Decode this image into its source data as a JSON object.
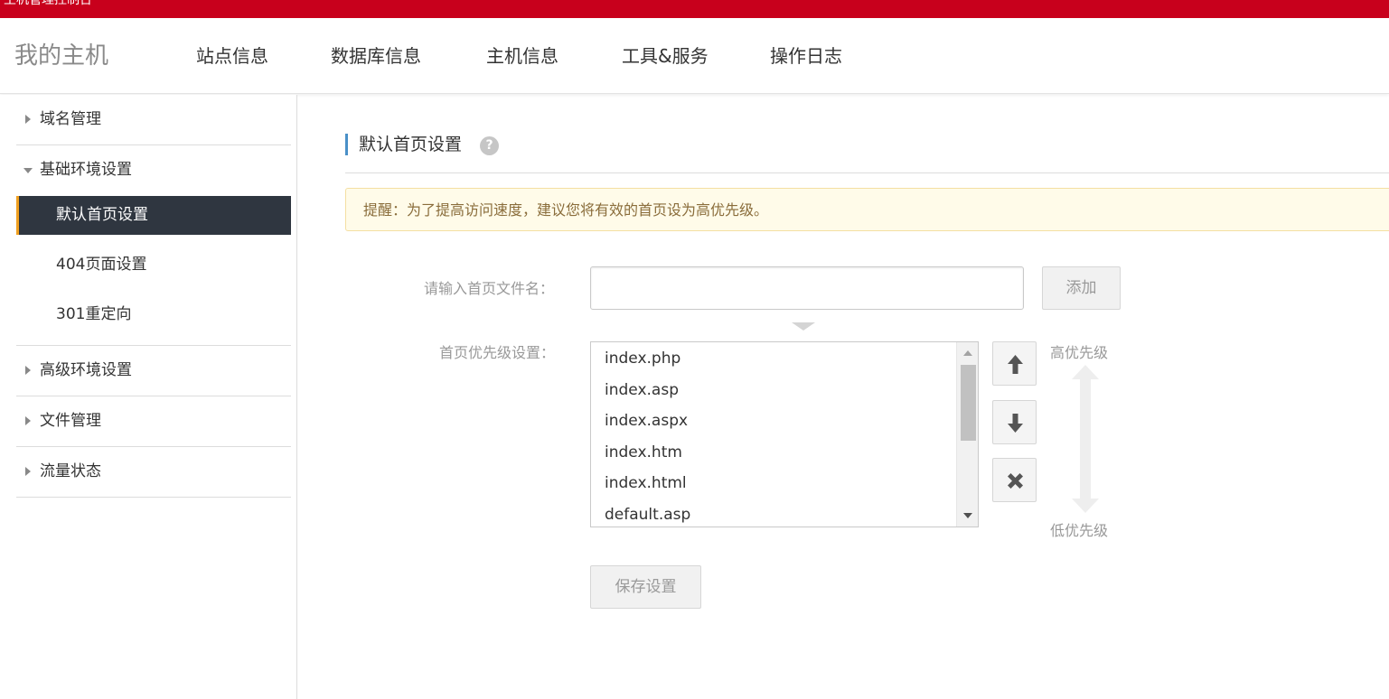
{
  "topbar": {
    "title": "主机管理控制台"
  },
  "header": {
    "brand": "我的主机",
    "nav": [
      "站点信息",
      "数据库信息",
      "主机信息",
      "工具&服务",
      "操作日志"
    ]
  },
  "sidebar": {
    "domain": "域名管理",
    "basic_env": "基础环境设置",
    "default_page": "默认首页设置",
    "page_404": "404页面设置",
    "redirect_301": "301重定向",
    "advanced_env": "高级环境设置",
    "file_mgmt": "文件管理",
    "traffic": "流量状态"
  },
  "main": {
    "title": "默认首页设置",
    "help": "?",
    "tip": "提醒：为了提高访问速度，建议您将有效的首页设为高优先级。",
    "input_label": "请输入首页文件名：",
    "input_value": "",
    "add_label": "添加",
    "priority_label": "首页优先级设置：",
    "files": [
      "index.php",
      "index.asp",
      "index.aspx",
      "index.htm",
      "index.html",
      "default.asp"
    ],
    "high_priority": "高优先级",
    "low_priority": "低优先级",
    "save_label": "保存设置"
  },
  "colors": {
    "topbar": "#c8001c",
    "active_item": "#2f3640",
    "active_accent": "#f0a020",
    "section_accent": "#4a90c8"
  },
  "icons": {
    "move_up": "arrow-up-icon",
    "move_down": "arrow-down-icon",
    "remove": "x-icon",
    "help": "question-mark-icon"
  }
}
